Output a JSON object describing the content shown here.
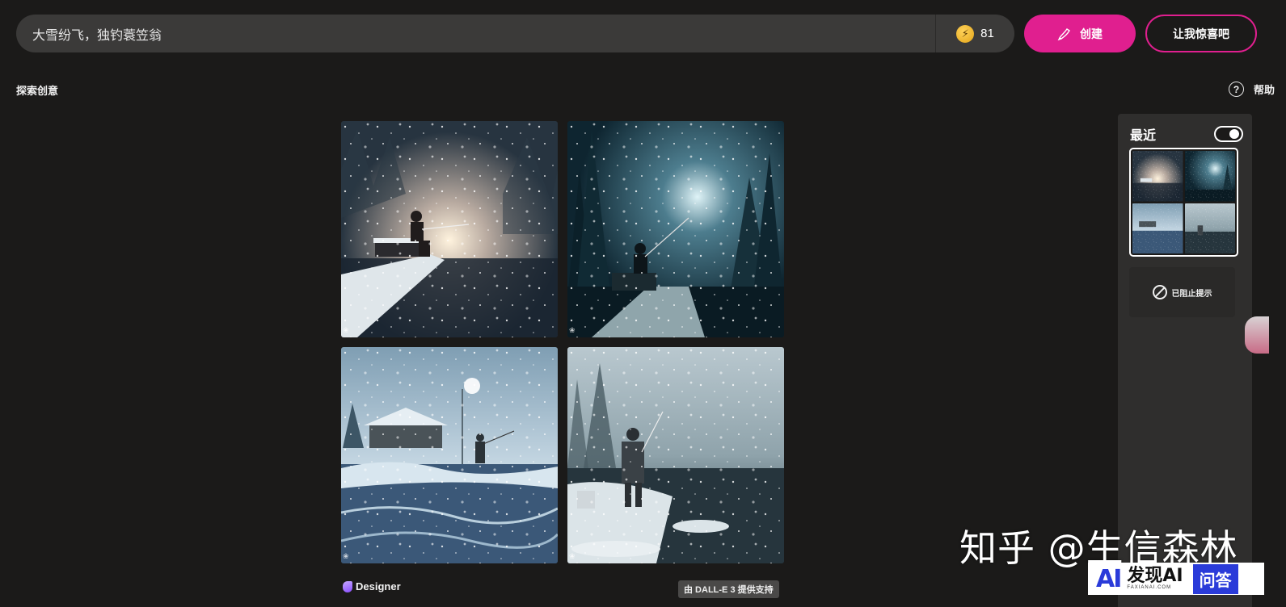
{
  "prompt": {
    "value": "大雪纷飞，独钓蓑笠翁",
    "boost_icon": "lightning-coin-icon",
    "boost_count": "81"
  },
  "actions": {
    "create_label": "创建",
    "create_icon": "brush-icon",
    "surprise_label": "让我惊喜吧",
    "accent_color": "#e01f8f"
  },
  "section": {
    "title": "探索创意",
    "help_label": "帮助",
    "help_icon": "question-circle-icon"
  },
  "results": {
    "tile_marks": [
      "❀",
      "❀",
      "❀",
      "❀"
    ],
    "brand": "Designer",
    "badge": "由 DALL-E 3 提供支持"
  },
  "recent": {
    "title": "最近",
    "toggle_on": true,
    "blocked_label": "已阻止提示",
    "blocked_icon": "blocked-circle-icon"
  },
  "watermarks": {
    "zhihu": "知乎 @生信森林",
    "faxian_logo": "AI",
    "faxian_name": "发现AI",
    "faxian_url": "FAXIANAI.COM",
    "faxian_qa": "问答"
  }
}
